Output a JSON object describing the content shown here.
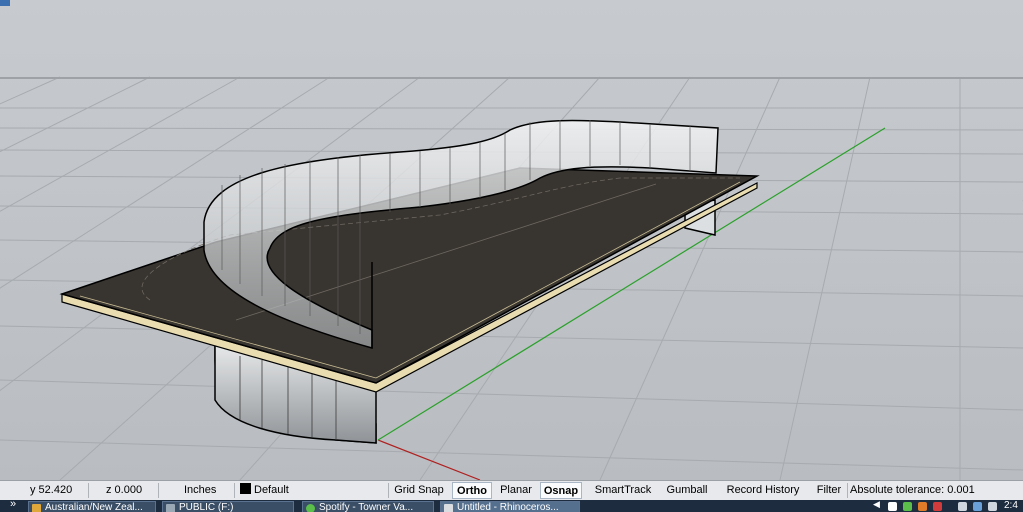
{
  "status_bar": {
    "y_coord": "y 52.420",
    "z_coord": "z 0.000",
    "units": "Inches",
    "layer": "Default",
    "toggles": [
      {
        "label": "Grid Snap",
        "on": false
      },
      {
        "label": "Ortho",
        "on": true
      },
      {
        "label": "Planar",
        "on": false
      },
      {
        "label": "Osnap",
        "on": true
      },
      {
        "label": "SmartTrack",
        "on": false
      },
      {
        "label": "Gumball",
        "on": false
      },
      {
        "label": "Record History",
        "on": false
      },
      {
        "label": "Filter",
        "on": false
      }
    ],
    "tolerance": "Absolute tolerance: 0.001"
  },
  "taskbar": {
    "overflow": "»",
    "items": [
      {
        "label": "Australian/New Zeal...",
        "icon": "folder-icon",
        "color": "#e0a83a"
      },
      {
        "label": "PUBLIC (F:)",
        "icon": "drive-icon",
        "color": "#9aa7b5"
      },
      {
        "label": "Spotify - Towner Va...",
        "icon": "spotify-icon",
        "color": "#5bbd4a"
      },
      {
        "label": "Untitled - Rhinoceros...",
        "icon": "rhino-icon",
        "color": "#d9dde2"
      }
    ],
    "clock": "2:4"
  },
  "colors": {
    "viewport_bg": "#bfc3c7",
    "grid_line": "#a7abb0",
    "x_axis": "#b02020",
    "y_axis": "#2aa02a",
    "slab_top": "#38342f",
    "slab_edge": "#e8dcb0"
  }
}
